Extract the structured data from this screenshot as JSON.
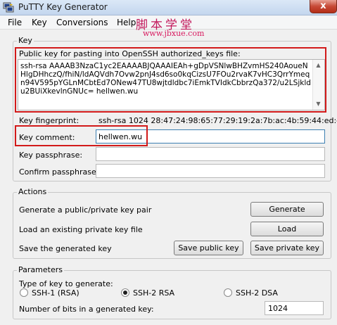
{
  "window": {
    "title": "PuTTY Key Generator",
    "close_glyph": "x"
  },
  "watermark": {
    "cn": "脚本学堂",
    "url": "www.jbxue.com"
  },
  "menu": [
    "File",
    "Key",
    "Conversions",
    "Help"
  ],
  "key_group": {
    "title": "Key",
    "public_key_label": "Public key for pasting into OpenSSH authorized_keys file:",
    "public_key_text": "ssh-rsa AAAAB3NzaC1yc2EAAAABJQAAAIEAh+gDpVSNlwBHZvmHS240AoueNHlgDHhczQ/fhiN/ldAQVdh7Ovw2pnJ4sd6so0kqCizsU7FOu2rvaK7vHC3QrrYmeqn94V595pYGLnMCbtEd7ONew47TU8wjtdldbc7iEmkTVIdkCbbrzQa372/u2LSjkldu2BUiXkevlnGNUc= hellwen.wu",
    "fingerprint_label": "Key fingerprint:",
    "fingerprint_value": "ssh-rsa 1024 28:47:24:98:65:77:29:19:2a:7b:ac:4b:59:44:ed:db",
    "comment_label": "Key comment:",
    "comment_value": "hellwen.wu",
    "passphrase_label": "Key passphrase:",
    "passphrase_value": "",
    "confirm_label": "Confirm passphrase:",
    "confirm_value": ""
  },
  "actions": {
    "title": "Actions",
    "generate_label": "Generate a public/private key pair",
    "generate_button": "Generate",
    "load_label": "Load an existing private key file",
    "load_button": "Load",
    "save_label": "Save the generated key",
    "save_public_button": "Save public key",
    "save_private_button": "Save private key"
  },
  "parameters": {
    "title": "Parameters",
    "type_label": "Type of key to generate:",
    "options": [
      {
        "label": "SSH-1 (RSA)",
        "selected": false
      },
      {
        "label": "SSH-2 RSA",
        "selected": true
      },
      {
        "label": "SSH-2 DSA",
        "selected": false
      }
    ],
    "bits_label": "Number of bits in a generated key:",
    "bits_value": "1024"
  },
  "colors": {
    "highlight": "#d21a1a",
    "watermark": "#c2185b"
  }
}
